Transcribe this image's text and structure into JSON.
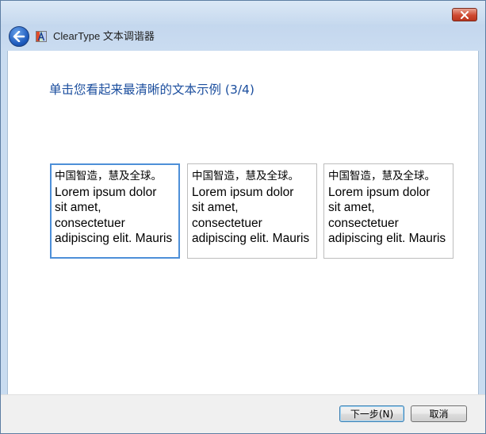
{
  "window": {
    "title": "ClearType 文本调谐器"
  },
  "main": {
    "instruction": "单击您看起来最清晰的文本示例 (3/4)",
    "samples": [
      {
        "selected": true,
        "lines": [
          "中国智造，慧及全球。",
          "Lorem ipsum dolor",
          "sit amet,",
          "consectetuer",
          "adipiscing elit. Mauris"
        ]
      },
      {
        "selected": false,
        "lines": [
          "中国智造，慧及全球。",
          "Lorem ipsum dolor",
          "sit amet,",
          "consectetuer",
          "adipiscing elit. Mauris"
        ]
      },
      {
        "selected": false,
        "lines": [
          "中国智造，慧及全球。",
          "Lorem ipsum dolor",
          "sit amet,",
          "consectetuer",
          "adipiscing elit. Mauris"
        ]
      }
    ]
  },
  "footer": {
    "next_label": "下一步(N)",
    "cancel_label": "取消"
  },
  "icons": {
    "close": "close-icon",
    "back": "back-arrow-icon",
    "app": "cleartype-icon"
  },
  "colors": {
    "instruction": "#1b4e9e",
    "selected_border": "#4d8fd8",
    "close_button": "#cf4a31"
  }
}
